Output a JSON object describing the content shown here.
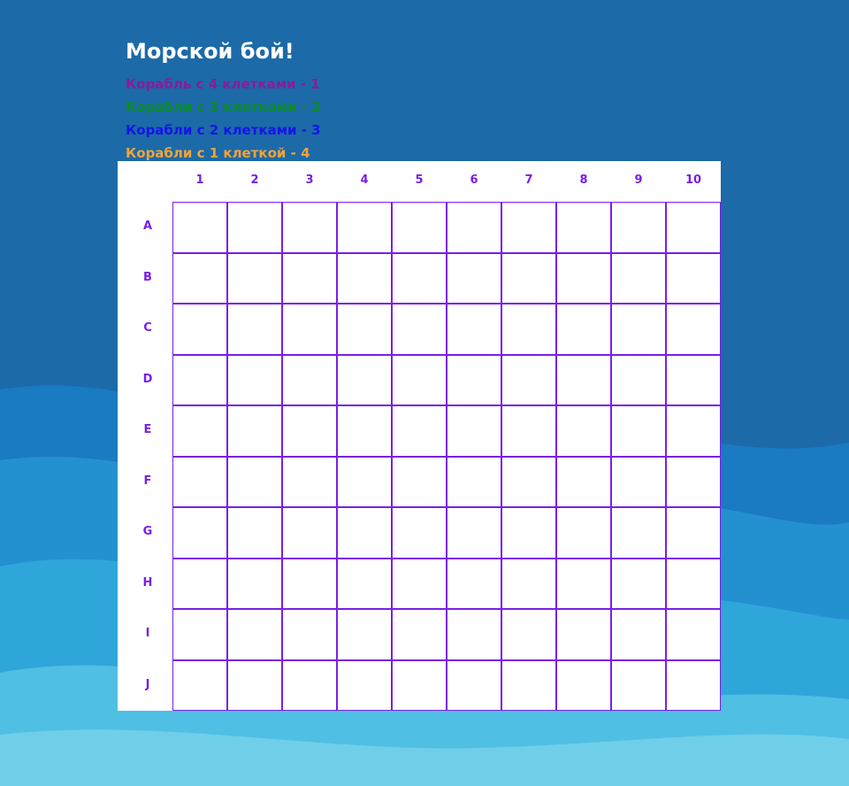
{
  "game": {
    "title": "Морской бой!",
    "legend": [
      {
        "text": "Корабль с 4 клетками - 1",
        "color": "#8b1a9e"
      },
      {
        "text": "Корабли с 3 клетками - 2",
        "color": "#0a8a2a"
      },
      {
        "text": "Корабли с 2 клетками - 3",
        "color": "#1515e6"
      },
      {
        "text": "Корабли с 1 клеткой - 4",
        "color": "#f2a33a"
      }
    ],
    "columns": [
      "1",
      "2",
      "3",
      "4",
      "5",
      "6",
      "7",
      "8",
      "9",
      "10"
    ],
    "rows": [
      "A",
      "B",
      "C",
      "D",
      "E",
      "F",
      "G",
      "H",
      "I",
      "J"
    ],
    "grid_color": "#7a1fe6"
  }
}
